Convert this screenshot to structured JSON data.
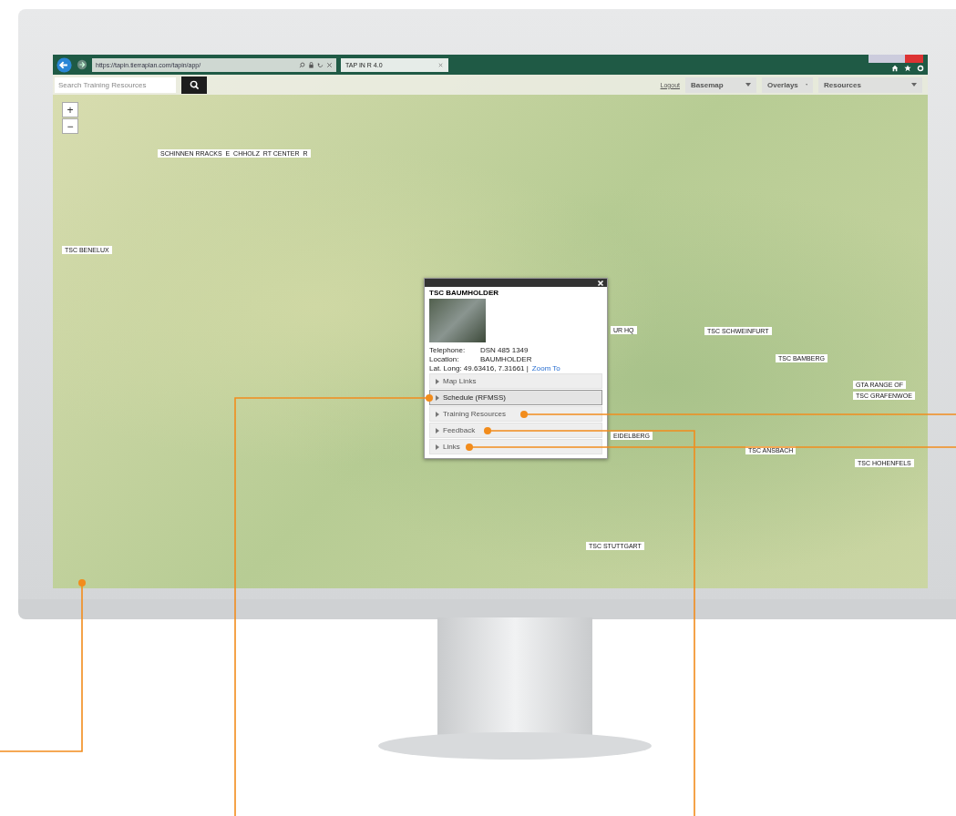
{
  "browser": {
    "url": "https://tapin.tierraplan.com/tapin/app/",
    "tab_title": "TAP IN R 4.0"
  },
  "toolbar": {
    "search_placeholder": "Search Training Resources",
    "logout": "Logout",
    "dropdowns": [
      "Basemap",
      "Overlays",
      "Resources"
    ]
  },
  "zoom_controls": [
    "+",
    "−"
  ],
  "map_labels": [
    {
      "text": "TSC BENELUX"
    },
    {
      "text": "SCHINNEN RRACKS  E  CHHOLZ  RT CENTER  R"
    },
    {
      "text": "UR HQ"
    },
    {
      "text": "TSC SCHWEINFURT"
    },
    {
      "text": "TSC BAMBERG"
    },
    {
      "text": "GTA RANGE OF"
    },
    {
      "text": "TSC GRAFENWOE"
    },
    {
      "text": "EIDELBERG"
    },
    {
      "text": "TSC ANSBACH"
    },
    {
      "text": "TSC HOHENFELS"
    },
    {
      "text": "TSC STUTTGART"
    }
  ],
  "popup": {
    "title": "TSC BAUMHOLDER",
    "fields": [
      {
        "label": "Telephone:",
        "value": "DSN 485 1349"
      },
      {
        "label": "Location:",
        "value": "BAUMHOLDER"
      }
    ],
    "coords": "Lat. Long: 49.63416, 7.31661 |",
    "zoom_link": "Zoom To",
    "sections": [
      {
        "label": "Map Links",
        "selected": false
      },
      {
        "label": "Schedule (RFMSS)",
        "selected": true
      },
      {
        "label": "Training Resources",
        "selected": false
      },
      {
        "label": "Feedback",
        "selected": false
      },
      {
        "label": "Links",
        "selected": false
      }
    ]
  }
}
